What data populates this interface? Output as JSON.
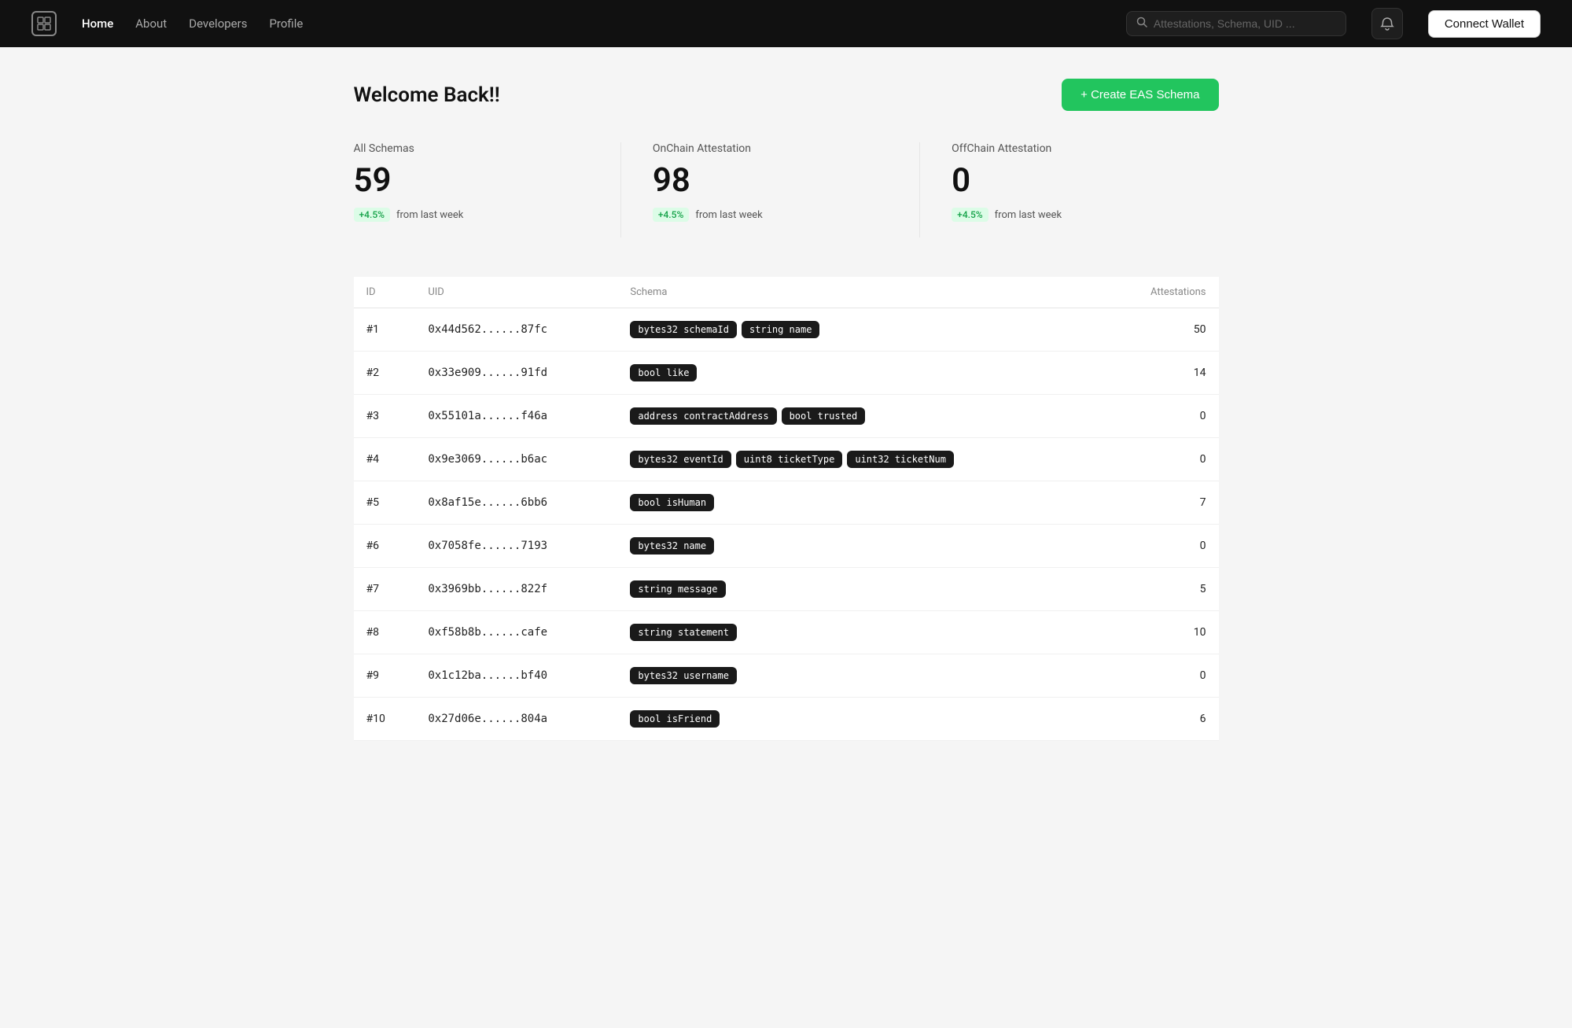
{
  "navbar": {
    "logo_symbol": "□",
    "links": [
      {
        "label": "Home",
        "active": true
      },
      {
        "label": "About",
        "active": false
      },
      {
        "label": "Developers",
        "active": false
      },
      {
        "label": "Profile",
        "active": false
      }
    ],
    "search_placeholder": "Attestations, Schema, UID ...",
    "connect_wallet_label": "Connect Wallet",
    "notification_icon": "🔔"
  },
  "header": {
    "welcome": "Welcome Back!!",
    "create_button": "+ Create EAS Schema"
  },
  "stats": [
    {
      "label": "All Schemas",
      "value": "59",
      "change": "+4.5%",
      "change_text": "from last week"
    },
    {
      "label": "OnChain Attestation",
      "value": "98",
      "change": "+4.5%",
      "change_text": "from last week"
    },
    {
      "label": "OffChain Attestation",
      "value": "0",
      "change": "+4.5%",
      "change_text": "from last week"
    }
  ],
  "table": {
    "columns": [
      "ID",
      "UID",
      "Schema",
      "Attestations"
    ],
    "rows": [
      {
        "id": "#1",
        "uid": "0x44d562......87fc",
        "tags": [
          "bytes32 schemaId",
          "string name"
        ],
        "attestations": "50"
      },
      {
        "id": "#2",
        "uid": "0x33e909......91fd",
        "tags": [
          "bool like"
        ],
        "attestations": "14"
      },
      {
        "id": "#3",
        "uid": "0x55101a......f46a",
        "tags": [
          "address contractAddress",
          "bool trusted"
        ],
        "attestations": "0"
      },
      {
        "id": "#4",
        "uid": "0x9e3069......b6ac",
        "tags": [
          "bytes32 eventId",
          "uint8 ticketType",
          "uint32 ticketNum"
        ],
        "attestations": "0"
      },
      {
        "id": "#5",
        "uid": "0x8af15e......6bb6",
        "tags": [
          "bool isHuman"
        ],
        "attestations": "7"
      },
      {
        "id": "#6",
        "uid": "0x7058fe......7193",
        "tags": [
          "bytes32 name"
        ],
        "attestations": "0"
      },
      {
        "id": "#7",
        "uid": "0x3969bb......822f",
        "tags": [
          "string message"
        ],
        "attestations": "5"
      },
      {
        "id": "#8",
        "uid": "0xf58b8b......cafe",
        "tags": [
          "string statement"
        ],
        "attestations": "10"
      },
      {
        "id": "#9",
        "uid": "0x1c12ba......bf40",
        "tags": [
          "bytes32 username"
        ],
        "attestations": "0"
      },
      {
        "id": "#10",
        "uid": "0x27d06e......804a",
        "tags": [
          "bool isFriend"
        ],
        "attestations": "6"
      }
    ]
  }
}
